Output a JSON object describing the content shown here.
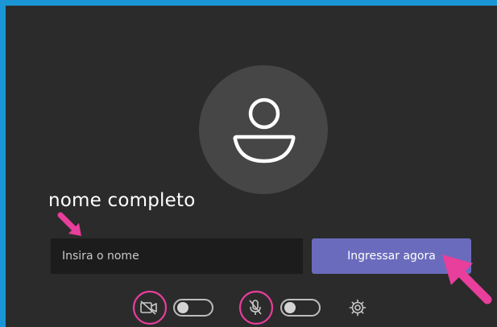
{
  "annotation": {
    "label": "nome completo",
    "highlight_color": "#e83e9c"
  },
  "name_field": {
    "placeholder": "Insira o nome",
    "value": ""
  },
  "join_button": {
    "label": "Ingressar agora",
    "color": "#6b6bbd"
  },
  "controls": {
    "camera_icon": "camera-off-icon",
    "camera_on": false,
    "mic_icon": "mic-off-icon",
    "mic_on": false,
    "settings_icon": "gear-icon"
  },
  "colors": {
    "frame": "#1a96d6",
    "background": "#2b2b2b",
    "avatar_circle": "#464646"
  }
}
